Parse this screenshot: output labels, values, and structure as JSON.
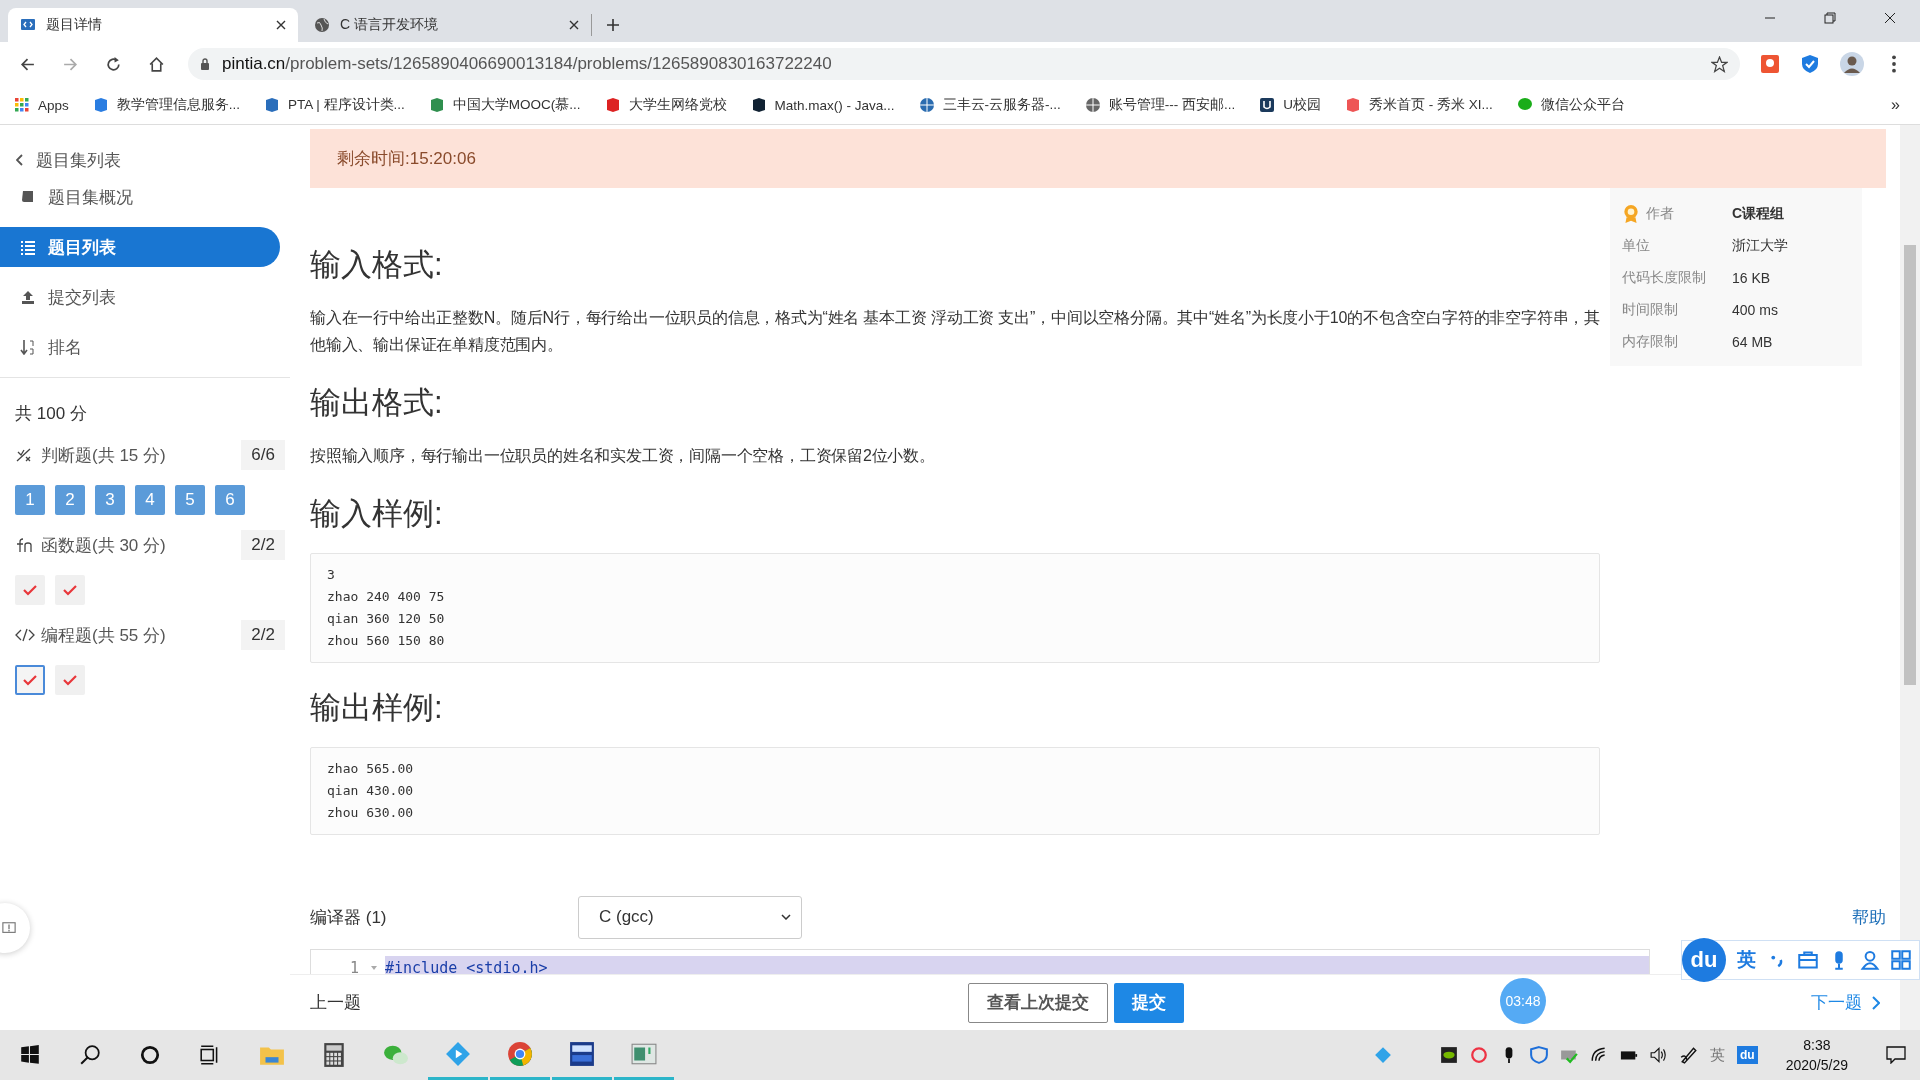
{
  "browser": {
    "tabs": [
      {
        "title": "题目详情",
        "selected": true
      },
      {
        "title": "C 语言开发环境",
        "selected": false
      }
    ],
    "url_host": "pintia.cn",
    "url_path": "/problem-sets/1265890406690013184/problems/1265890830163722240",
    "bookmarks": [
      "Apps",
      "教学管理信息服务...",
      "PTA | 程序设计类...",
      "中国大学MOOC(慕...",
      "大学生网络党校",
      "Math.max() - Java...",
      "三丰云-云服务器-...",
      "账号管理--- 西安邮...",
      "U校园",
      "秀米首页 - 秀米 XI...",
      "微信公众平台"
    ],
    "bookmarks_more": "»"
  },
  "sidebar": {
    "back": "题目集列表",
    "nav": [
      {
        "label": "题目集概况",
        "selected": false
      },
      {
        "label": "题目列表",
        "selected": true
      },
      {
        "label": "提交列表",
        "selected": false
      },
      {
        "label": "排名",
        "selected": false
      }
    ],
    "total": "共 100 分",
    "groups": [
      {
        "kind": "judge",
        "title": "判断题(共 15 分)",
        "count": "6/6",
        "items": [
          {
            "label": "1",
            "selected": false
          },
          {
            "label": "2",
            "selected": false
          },
          {
            "label": "3",
            "selected": false
          },
          {
            "label": "4",
            "selected": false
          },
          {
            "label": "5",
            "selected": false
          },
          {
            "label": "6",
            "selected": false
          }
        ]
      },
      {
        "kind": "function",
        "title": "函数题(共 30 分)",
        "count": "2/2",
        "items": [
          {
            "passed": true,
            "selected": false
          },
          {
            "passed": true,
            "selected": false
          }
        ]
      },
      {
        "kind": "program",
        "title": "编程题(共 55 分)",
        "count": "2/2",
        "items": [
          {
            "passed": true,
            "selected": true
          },
          {
            "passed": true,
            "selected": false
          }
        ]
      }
    ]
  },
  "timer_banner": "剩余时间:15:20:06",
  "problem": {
    "sections": [
      {
        "heading": "输入格式:",
        "text": "输入在一行中给出正整数N。随后N行，每行给出一位职员的信息，格式为“姓名 基本工资 浮动工资 支出”，中间以空格分隔。其中“姓名”为长度小于10的不包含空白字符的非空字符串，其他输入、输出保证在单精度范围内。"
      },
      {
        "heading": "输出格式:",
        "text": "按照输入顺序，每行输出一位职员的姓名和实发工资，间隔一个空格，工资保留2位小数。"
      },
      {
        "heading": "输入样例:",
        "code": [
          "3",
          "zhao 240 400 75",
          "qian 360 120 50",
          "zhou 560 150 80"
        ]
      },
      {
        "heading": "输出样例:",
        "code": [
          "zhao 565.00",
          "qian 430.00",
          "zhou 630.00"
        ]
      }
    ]
  },
  "info": [
    {
      "label": "作者",
      "value": "C课程组"
    },
    {
      "label": "单位",
      "value": "浙江大学"
    },
    {
      "label": "代码长度限制",
      "value": "16 KB"
    },
    {
      "label": "时间限制",
      "value": "400 ms"
    },
    {
      "label": "内存限制",
      "value": "64 MB"
    }
  ],
  "editor": {
    "label": "编译器 (1)",
    "compiler": "C (gcc)",
    "help": "帮助",
    "lines": [
      {
        "number": "1",
        "text": "#include <stdio.h>"
      }
    ]
  },
  "footer": {
    "prev": "上一题",
    "view_last": "查看上次提交",
    "submit": "提交",
    "next": "下一题"
  },
  "timer_bubble": "03:48",
  "ime": {
    "logo": "du",
    "mode": "英"
  },
  "taskbar": {
    "apps": [
      {
        "active": false
      },
      {
        "active": false
      },
      {
        "active": false
      },
      {
        "active": true
      },
      {
        "active": true
      },
      {
        "active": true
      },
      {
        "active": true
      }
    ],
    "time": "8:38",
    "date": "2020/5/29",
    "tray_logo": "du",
    "tray_lang": "英"
  }
}
